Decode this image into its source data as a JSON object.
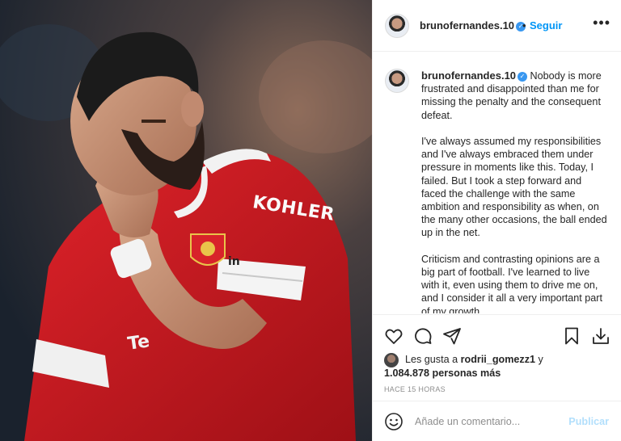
{
  "post": {
    "username": "brunofernandes.10",
    "follow_label": "Seguir",
    "dot": "•",
    "more_label": "•••",
    "caption_paragraphs": [
      "Nobody is more frustrated and disappointed than me for missing the penalty and the consequent defeat.",
      "I've always assumed my responsibilities and I've always embraced them under pressure in moments like this. Today, I failed. But I took a step forward and faced the challenge with the same ambition and responsibility as when, on the many other occasions, the ball ended up in the net.",
      "Criticism and contrasting opinions are a big part of football. I've learned to live with it, even using them to drive me on, and I consider it all a very important part of my growth."
    ],
    "likes_prefix": "Les gusta a ",
    "likes_user": "rodrii_gomezz1",
    "likes_suffix": " y",
    "likes_count": "1.084.878 personas más",
    "timestamp": "HACE 15 HORAS",
    "comment_placeholder": "Añade un comentario...",
    "publish_label": "Publicar",
    "jersey_sponsor": "KOHLER",
    "jersey_back_text": "Te",
    "armband_text": "in"
  },
  "icons": [
    "heart-icon",
    "comment-icon",
    "share-icon",
    "bookmark-icon",
    "download-icon",
    "emoji-icon",
    "verified-icon"
  ],
  "colors": {
    "link_blue": "#0095f6",
    "verified_blue": "#3897f0",
    "jersey_red": "#d81920",
    "muted_text": "#8e8e8e",
    "publish_disabled": "#b2dffc"
  }
}
